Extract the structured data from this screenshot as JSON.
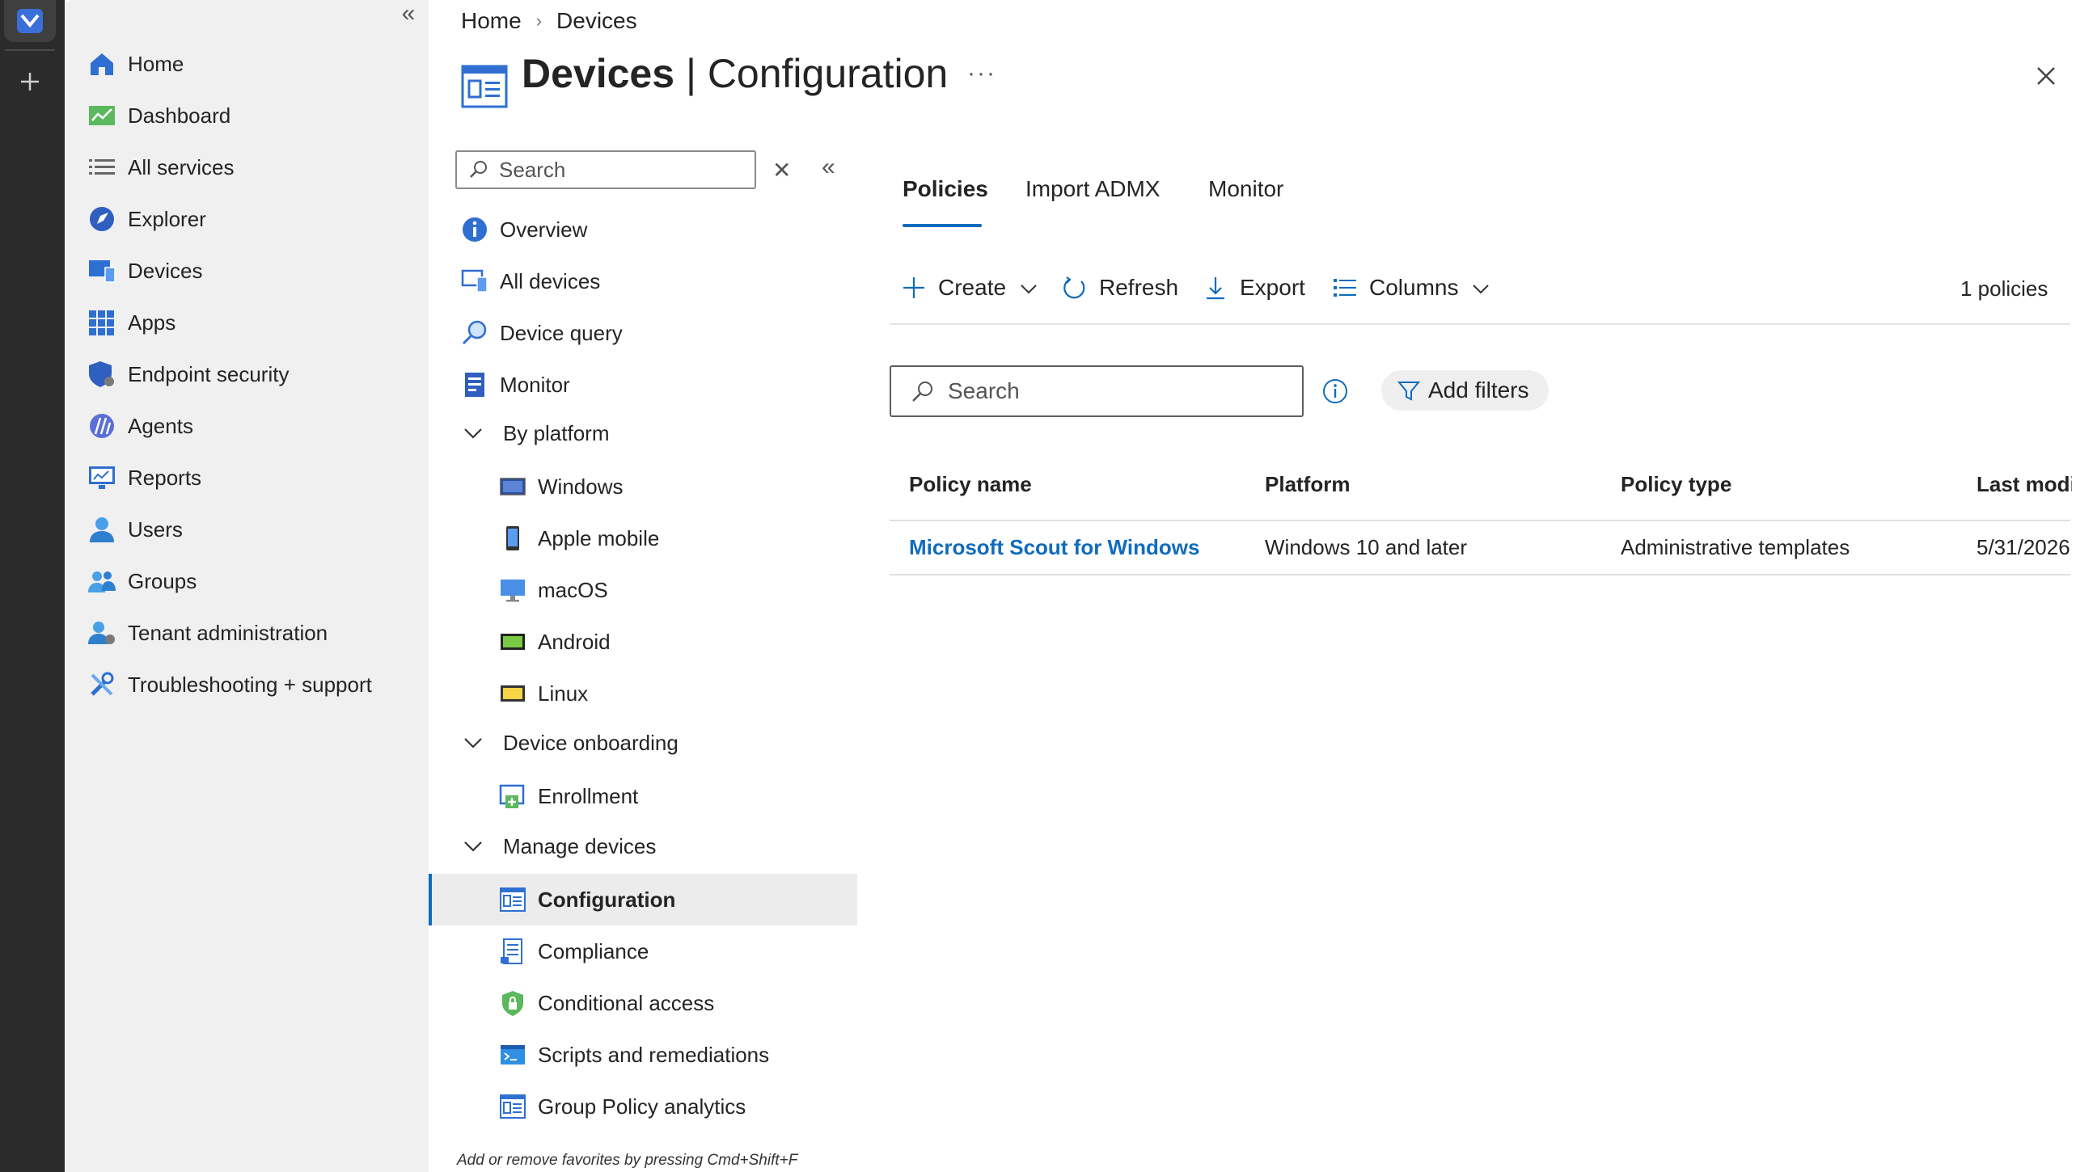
{
  "portal_nav": {
    "items": [
      {
        "label": "Home",
        "icon": "home-icon"
      },
      {
        "label": "Dashboard",
        "icon": "dashboard-icon"
      },
      {
        "label": "All services",
        "icon": "list-icon"
      },
      {
        "label": "Explorer",
        "icon": "explorer-icon"
      },
      {
        "label": "Devices",
        "icon": "devices-icon"
      },
      {
        "label": "Apps",
        "icon": "apps-icon"
      },
      {
        "label": "Endpoint security",
        "icon": "shield-icon"
      },
      {
        "label": "Agents",
        "icon": "agents-icon"
      },
      {
        "label": "Reports",
        "icon": "reports-icon"
      },
      {
        "label": "Users",
        "icon": "user-icon"
      },
      {
        "label": "Groups",
        "icon": "groups-icon"
      },
      {
        "label": "Tenant administration",
        "icon": "tenant-admin-icon"
      },
      {
        "label": "Troubleshooting + support",
        "icon": "wrench-icon"
      }
    ]
  },
  "breadcrumb": {
    "home": "Home",
    "current": "Devices"
  },
  "header": {
    "title_bold": "Devices",
    "title_rest": " | Configuration",
    "more": "···"
  },
  "resource_menu": {
    "search_placeholder": "Search",
    "items": {
      "overview": "Overview",
      "all_devices": "All devices",
      "device_query": "Device query",
      "monitor": "Monitor",
      "by_platform": "By platform",
      "windows": "Windows",
      "apple_mobile": "Apple mobile",
      "macos": "macOS",
      "android": "Android",
      "linux": "Linux",
      "device_onboarding": "Device onboarding",
      "enrollment": "Enrollment",
      "manage_devices": "Manage devices",
      "configuration": "Configuration",
      "compliance": "Compliance",
      "conditional_access": "Conditional access",
      "scripts": "Scripts and remediations",
      "gp_analytics": "Group Policy analytics"
    },
    "footer": "Add or remove favorites by pressing Cmd+Shift+F"
  },
  "tabs": [
    "Policies",
    "Import ADMX",
    "Monitor"
  ],
  "toolbar": {
    "create": "Create",
    "refresh": "Refresh",
    "export": "Export",
    "columns": "Columns",
    "count": "1 policies"
  },
  "filters": {
    "search_placeholder": "Search",
    "add_filters": "Add filters"
  },
  "table": {
    "columns": [
      "Policy name",
      "Platform",
      "Policy type",
      "Last modi"
    ],
    "rows": [
      {
        "name": "Microsoft Scout for Windows",
        "platform": "Windows 10 and later",
        "type": "Administrative templates",
        "modified": "5/31/2026,"
      }
    ]
  },
  "colors": {
    "accent": "#0f6cbd",
    "selected_bg": "#ececec",
    "nav_bg": "#f0f0f0",
    "rail_bg": "#2b2b2b"
  }
}
